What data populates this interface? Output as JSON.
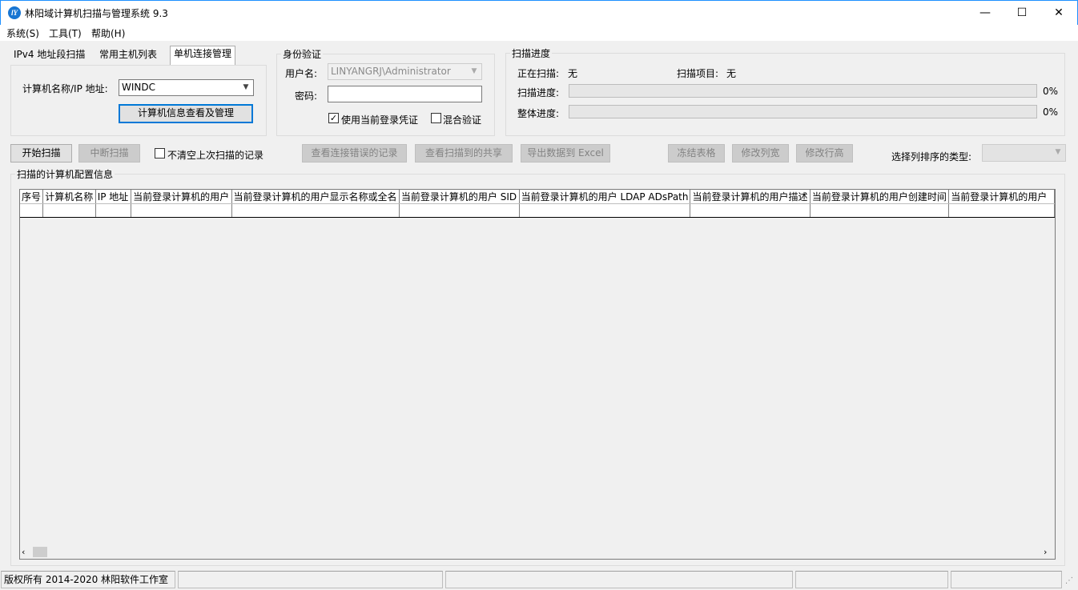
{
  "window": {
    "title": "林阳域计算机扫描与管理系统 9.3",
    "icon_text": "lY",
    "minimize": "—",
    "maximize": "☐",
    "close": "✕"
  },
  "menu": [
    "系统(S)",
    "工具(T)",
    "帮助(H)"
  ],
  "tabs": [
    "IPv4 地址段扫描",
    "常用主机列表",
    "单机连接管理"
  ],
  "single": {
    "host_label": "计算机名称/IP 地址:",
    "host_value": "WINDC",
    "manage_button": "计算机信息查看及管理"
  },
  "auth": {
    "legend": "身份验证",
    "username_label": "用户名:",
    "username_value": "LINYANGRJ\\Administrator",
    "password_label": "密码:",
    "password_value": "",
    "use_current_label": "使用当前登录凭证",
    "use_current_checked": "✓",
    "mixed_label": "混合验证"
  },
  "progress": {
    "legend": "扫描进度",
    "scanning_label": "正在扫描:",
    "scanning_value": "无",
    "item_label": "扫描项目:",
    "item_value": "无",
    "scan_label": "扫描进度:",
    "scan_pct": "0%",
    "scan_fraction": 0,
    "total_label": "整体进度:",
    "total_pct": "0%",
    "total_fraction": 0
  },
  "toolbar": {
    "start": "开始扫描",
    "stop": "中断扫描",
    "keep_label": "不清空上次扫描的记录",
    "view_errors": "查看连接错误的记录",
    "view_shares": "查看扫描到的共享",
    "export": "导出数据到 Excel",
    "freeze": "冻结表格",
    "col_width": "修改列宽",
    "row_height": "修改行高",
    "sort_label": "选择列排序的类型:"
  },
  "grid": {
    "legend": "扫描的计算机配置信息",
    "columns": [
      "序号",
      "计算机名称",
      "IP 地址",
      "当前登录计算机的用户",
      "当前登录计算机的用户显示名称或全名",
      "当前登录计算机的用户 SID",
      "当前登录计算机的用户 LDAP ADsPath",
      "当前登录计算机的用户描述",
      "当前登录计算机的用户创建时间",
      "当前登录计算机的用户"
    ]
  },
  "status": {
    "copyright": "版权所有 2014-2020 林阳软件工作室"
  }
}
